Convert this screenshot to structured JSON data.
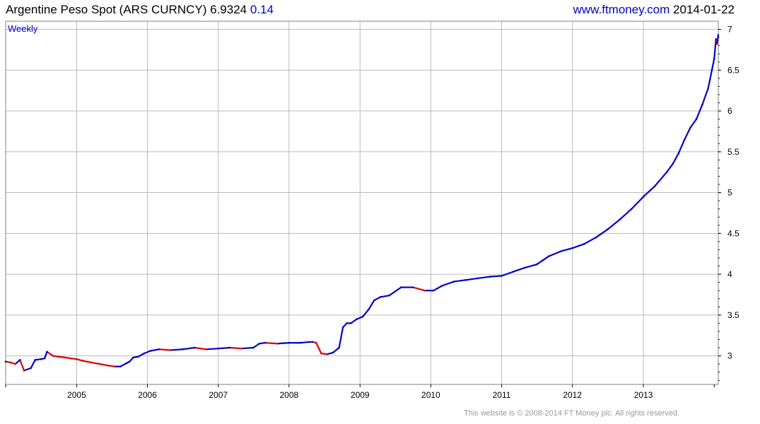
{
  "header": {
    "instrument": "Argentine Peso Spot (ARS CURNCY)",
    "last": "6.9324",
    "change": "0.14",
    "site": "www.ftmoney.com",
    "date": "2014-01-22"
  },
  "footer": {
    "copyright": "This website is © 2008-2014 FT Money plc. All rights reserved."
  },
  "colors": {
    "up": "#0000cc",
    "down": "#dd0000",
    "grid": "#bbbbbb",
    "frame": "#808080"
  },
  "chart_data": {
    "type": "line",
    "period_label": "Weekly",
    "y_ticks": [
      "3",
      "3.5",
      "4",
      "4.5",
      "5",
      "5.5",
      "6",
      "6.5",
      "7"
    ],
    "x_ticks": [
      "2005",
      "2006",
      "2007",
      "2008",
      "2009",
      "2010",
      "2011",
      "2012",
      "2013"
    ],
    "ylim": [
      2.65,
      7.1
    ],
    "xlim": [
      "2004-01-01",
      "2014-01-22"
    ],
    "series": [
      {
        "x": [
          "2004-01-01",
          "2004-01-25",
          "2004-02-20",
          "2004-03-15",
          "2004-04-05",
          "2004-05-10",
          "2004-06-01",
          "2004-07-01",
          "2004-07-20",
          "2004-08-01",
          "2004-09-01",
          "2004-10-01",
          "2004-11-01",
          "2004-12-01",
          "2005-01-01",
          "2005-02-01",
          "2005-03-15",
          "2005-05-01",
          "2005-06-15",
          "2005-07-15",
          "2005-08-15",
          "2005-09-15",
          "2005-10-01",
          "2005-10-20",
          "2005-11-15",
          "2005-12-15",
          "2006-01-15",
          "2006-03-01",
          "2006-05-01",
          "2006-07-01",
          "2006-09-01",
          "2006-11-01",
          "2007-01-01",
          "2007-03-01",
          "2007-05-01",
          "2007-07-01",
          "2007-08-01",
          "2007-09-01",
          "2007-11-01",
          "2008-01-01",
          "2008-03-01",
          "2008-04-15",
          "2008-05-01",
          "2008-05-20",
          "2008-06-15",
          "2008-07-15",
          "2008-08-15",
          "2008-09-15",
          "2008-10-05",
          "2008-10-25",
          "2008-11-15",
          "2008-12-15",
          "2009-01-15",
          "2009-02-15",
          "2009-03-15",
          "2009-04-15",
          "2009-06-01",
          "2009-08-01",
          "2009-10-01",
          "2009-12-01",
          "2010-01-15",
          "2010-03-01",
          "2010-05-01",
          "2010-07-01",
          "2010-09-01",
          "2010-11-01",
          "2011-01-01",
          "2011-03-01",
          "2011-05-01",
          "2011-07-01",
          "2011-08-01",
          "2011-09-01",
          "2011-11-01",
          "2012-01-01",
          "2012-03-01",
          "2012-05-01",
          "2012-07-01",
          "2012-09-01",
          "2012-11-01",
          "2013-01-01",
          "2013-03-01",
          "2013-05-01",
          "2013-06-01",
          "2013-07-01",
          "2013-08-01",
          "2013-09-01",
          "2013-10-01",
          "2013-11-01",
          "2013-12-01",
          "2013-12-20",
          "2014-01-01",
          "2014-01-10",
          "2014-01-15",
          "2014-01-22"
        ],
        "y": [
          2.93,
          2.92,
          2.9,
          2.95,
          2.82,
          2.85,
          2.95,
          2.96,
          2.97,
          3.05,
          3.0,
          2.99,
          2.98,
          2.97,
          2.96,
          2.94,
          2.92,
          2.9,
          2.88,
          2.87,
          2.87,
          2.91,
          2.93,
          2.98,
          2.99,
          3.03,
          3.06,
          3.08,
          3.07,
          3.08,
          3.1,
          3.08,
          3.09,
          3.1,
          3.09,
          3.1,
          3.15,
          3.16,
          3.15,
          3.16,
          3.16,
          3.17,
          3.17,
          3.16,
          3.03,
          3.02,
          3.04,
          3.1,
          3.35,
          3.4,
          3.4,
          3.45,
          3.48,
          3.57,
          3.68,
          3.72,
          3.74,
          3.84,
          3.84,
          3.8,
          3.8,
          3.86,
          3.91,
          3.93,
          3.95,
          3.97,
          3.98,
          4.03,
          4.08,
          4.12,
          4.17,
          4.22,
          4.28,
          4.32,
          4.37,
          4.45,
          4.55,
          4.67,
          4.8,
          4.95,
          5.08,
          5.25,
          5.35,
          5.48,
          5.65,
          5.8,
          5.9,
          6.08,
          6.28,
          6.5,
          6.64,
          6.88,
          6.82,
          6.93
        ]
      }
    ]
  }
}
